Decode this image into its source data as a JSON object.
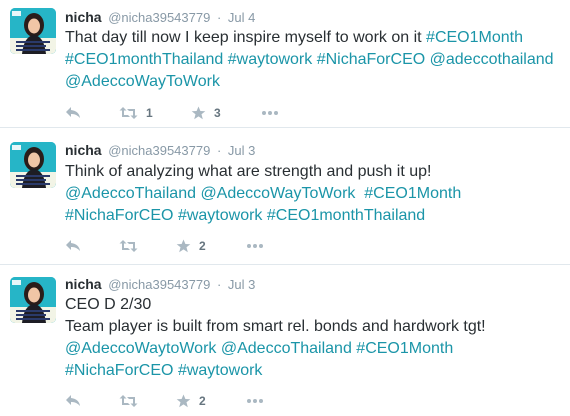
{
  "tweets": [
    {
      "name": "nicha",
      "handle": "@nicha39543779",
      "separator": "·",
      "date": "Jul 4",
      "lines": [
        [
          {
            "t": "That day till now I keep inspire myself to work on it ",
            "link": false
          },
          {
            "t": "#CEO1Month",
            "link": true
          }
        ],
        [
          {
            "t": "#CEO1monthThailand",
            "link": true
          },
          {
            "t": " ",
            "link": false
          },
          {
            "t": "#waytowork",
            "link": true
          },
          {
            "t": " ",
            "link": false
          },
          {
            "t": "#NichaForCEO",
            "link": true
          },
          {
            "t": " ",
            "link": false
          },
          {
            "t": "@adeccothailand",
            "link": true
          }
        ],
        [
          {
            "t": "@AdeccoWayToWork",
            "link": true
          }
        ]
      ],
      "retweets": "1",
      "favorites": "3"
    },
    {
      "name": "nicha",
      "handle": "@nicha39543779",
      "separator": "·",
      "date": "Jul 3",
      "lines": [
        [
          {
            "t": "Think of analyzing what are strength and push it up!",
            "link": false
          }
        ],
        [
          {
            "t": "@AdeccoThailand",
            "link": true
          },
          {
            "t": " ",
            "link": false
          },
          {
            "t": "@AdeccoWayToWork",
            "link": true
          },
          {
            "t": "  ",
            "link": false
          },
          {
            "t": "#CEO1Month",
            "link": true
          }
        ],
        [
          {
            "t": "#NichaForCEO",
            "link": true
          },
          {
            "t": " ",
            "link": false
          },
          {
            "t": "#waytowork",
            "link": true
          },
          {
            "t": " ",
            "link": false
          },
          {
            "t": "#CEO1monthThailand",
            "link": true
          }
        ]
      ],
      "retweets": "",
      "favorites": "2"
    },
    {
      "name": "nicha",
      "handle": "@nicha39543779",
      "separator": "·",
      "date": "Jul 3",
      "lines": [
        [
          {
            "t": "CEO D 2/30",
            "link": false
          }
        ],
        [
          {
            "t": "Team player is built from smart rel. bonds and hardwork tgt!",
            "link": false
          }
        ],
        [
          {
            "t": "@AdeccoWaytoWork",
            "link": true
          },
          {
            "t": " ",
            "link": false
          },
          {
            "t": "@AdeccoThailand",
            "link": true
          },
          {
            "t": " ",
            "link": false
          },
          {
            "t": "#CEO1Month",
            "link": true
          }
        ],
        [
          {
            "t": "#NichaForCEO",
            "link": true
          },
          {
            "t": " ",
            "link": false
          },
          {
            "t": "#waytowork",
            "link": true
          }
        ]
      ],
      "retweets": "",
      "favorites": "2"
    }
  ],
  "colors": {
    "link": "#1b95a8",
    "text": "#292f33",
    "meta": "#8899a6",
    "icon": "#aab8c2",
    "divider": "#e1e8ed"
  },
  "icons": [
    "reply-icon",
    "retweet-icon",
    "favorite-icon",
    "more-icon"
  ]
}
